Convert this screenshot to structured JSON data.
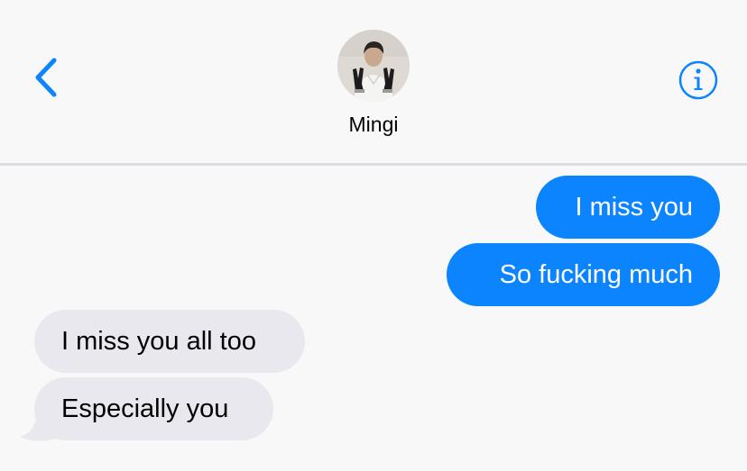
{
  "header": {
    "contact_name": "Mingi",
    "back_icon": "chevron-left-icon",
    "info_icon": "info-circle-icon"
  },
  "messages": [
    {
      "direction": "sent",
      "text": "I miss you"
    },
    {
      "direction": "sent",
      "text": "So fucking much"
    },
    {
      "direction": "received",
      "text": "I miss you all too"
    },
    {
      "direction": "received",
      "text": "Especially you"
    }
  ],
  "colors": {
    "accent": "#0b84fe",
    "sent_bubble": "#0b84fe",
    "received_bubble": "#e9e8ee",
    "background": "#f8f8f9",
    "divider": "#dedde3"
  }
}
